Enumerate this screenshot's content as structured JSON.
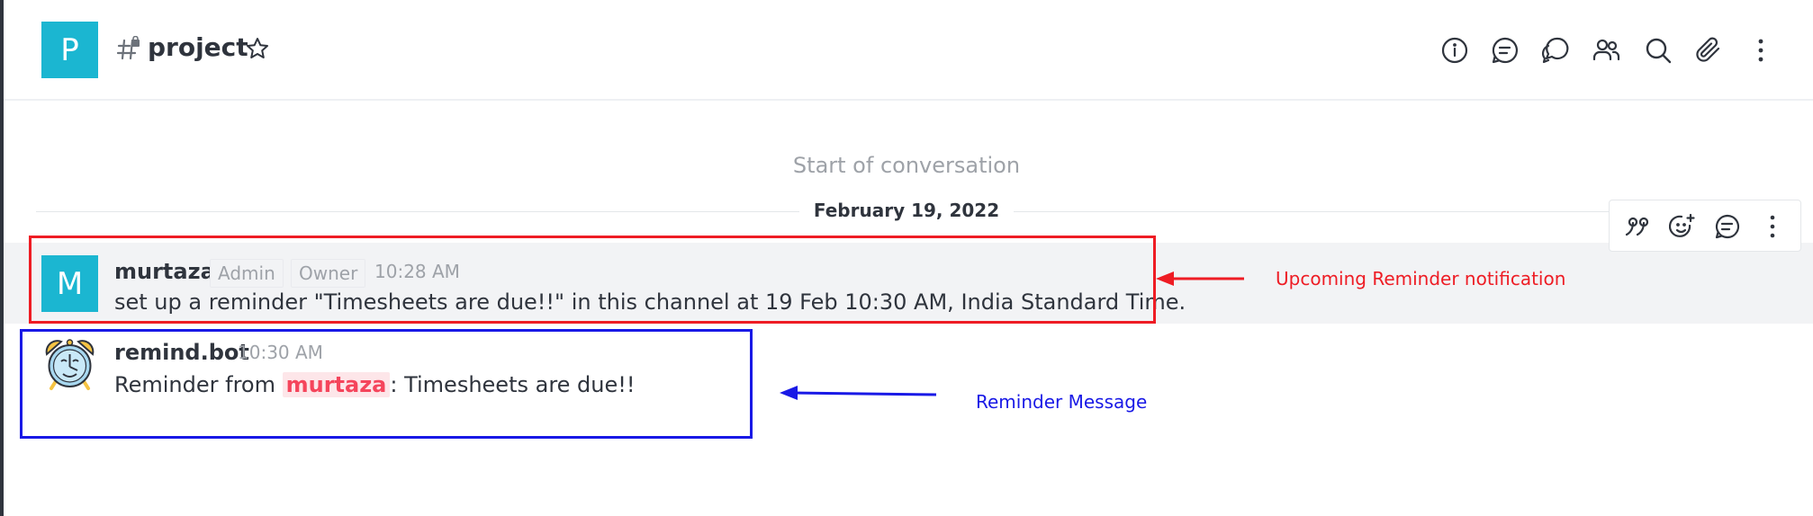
{
  "header": {
    "room_avatar_letter": "P",
    "room_name": "project",
    "icons": [
      "info-icon",
      "discussion-icon",
      "threads-icon",
      "members-icon",
      "search-icon",
      "attachment-icon",
      "kebab-menu-icon"
    ]
  },
  "conversation": {
    "start_text": "Start of conversation",
    "date_divider": "February 19, 2022",
    "messages": [
      {
        "avatar_letter": "M",
        "username": "murtaza",
        "roles": [
          "Admin",
          "Owner"
        ],
        "time": "10:28 AM",
        "text": "set up a reminder \"Timesheets are due!!\" in this channel at 19 Feb 10:30 AM, India Standard Time."
      },
      {
        "avatar_icon": "alarm-clock-icon",
        "username": "remind.bot",
        "time": "10:30 AM",
        "text_prefix": "Reminder from ",
        "mention": "murtaza",
        "text_suffix": ": Timesheets are due!!"
      }
    ]
  },
  "message_actions": [
    "quote-icon",
    "add-reaction-icon",
    "reply-in-thread-icon",
    "more-options-icon"
  ],
  "annotations": {
    "red_label": "Upcoming Reminder notification",
    "blue_label": "Reminder Message",
    "red_color": "#ee1c24",
    "blue_color": "#1919e6"
  },
  "colors": {
    "avatar_bg": "#1bb6d1",
    "mention_text": "#f5455c",
    "mention_bg": "#fde6e9"
  }
}
